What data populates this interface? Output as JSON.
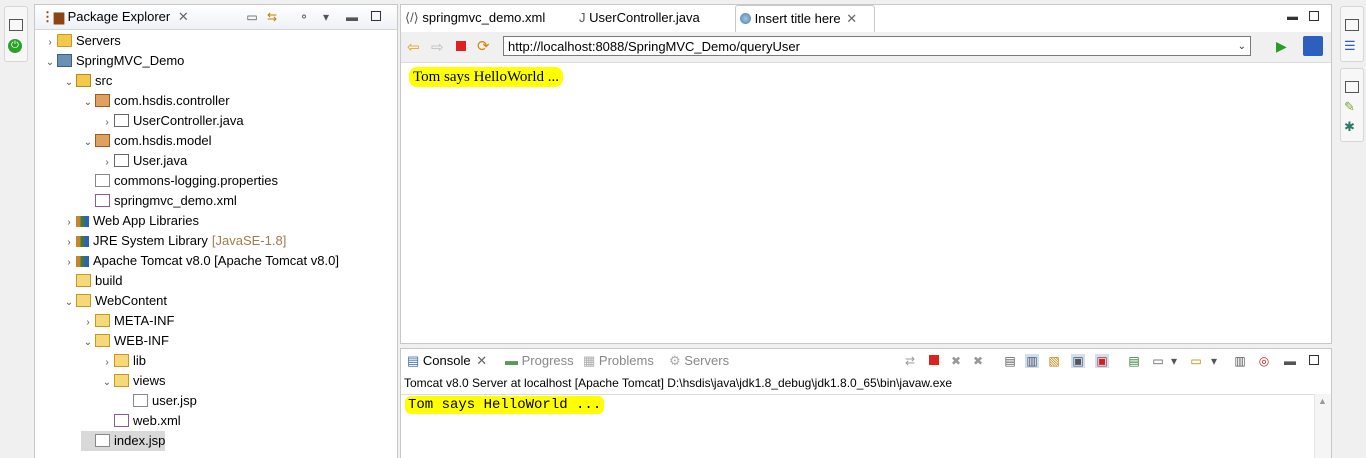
{
  "package_explorer": {
    "title": "Package Explorer",
    "tree": [
      {
        "label": "Servers",
        "icon": "folder-servers-icon",
        "expander": "collapsed",
        "depth": 0
      },
      {
        "label": "SpringMVC_Demo",
        "icon": "web-project-icon",
        "expander": "expanded",
        "depth": 0
      },
      {
        "label": "src",
        "icon": "source-folder-icon",
        "expander": "expanded",
        "depth": 1
      },
      {
        "label": "com.hsdis.controller",
        "icon": "package-icon",
        "expander": "expanded",
        "depth": 2
      },
      {
        "label": "UserController.java",
        "icon": "java-file-icon",
        "expander": "collapsed",
        "depth": 3
      },
      {
        "label": "com.hsdis.model",
        "icon": "package-icon",
        "expander": "expanded",
        "depth": 2
      },
      {
        "label": "User.java",
        "icon": "java-file-icon",
        "expander": "collapsed",
        "depth": 3
      },
      {
        "label": "commons-logging.properties",
        "icon": "properties-file-icon",
        "expander": "none",
        "depth": 2
      },
      {
        "label": "springmvc_demo.xml",
        "icon": "xml-file-icon",
        "expander": "none",
        "depth": 2
      },
      {
        "label": "Web App Libraries",
        "icon": "library-icon",
        "expander": "collapsed",
        "depth": 1
      },
      {
        "label": "JRE System Library",
        "suffix": "[JavaSE-1.8]",
        "icon": "library-icon",
        "expander": "collapsed",
        "depth": 1
      },
      {
        "label": "Apache Tomcat v8.0 [Apache Tomcat v8.0]",
        "icon": "library-icon",
        "expander": "collapsed",
        "depth": 1
      },
      {
        "label": "build",
        "icon": "folder-icon",
        "expander": "none",
        "depth": 1
      },
      {
        "label": "WebContent",
        "icon": "folder-icon",
        "expander": "expanded",
        "depth": 1
      },
      {
        "label": "META-INF",
        "icon": "folder-icon",
        "expander": "collapsed",
        "depth": 2
      },
      {
        "label": "WEB-INF",
        "icon": "folder-icon",
        "expander": "expanded",
        "depth": 2
      },
      {
        "label": "lib",
        "icon": "folder-icon",
        "expander": "collapsed",
        "depth": 3
      },
      {
        "label": "views",
        "icon": "folder-icon",
        "expander": "expanded",
        "depth": 3
      },
      {
        "label": "user.jsp",
        "icon": "jsp-file-icon",
        "expander": "none",
        "depth": 4
      },
      {
        "label": "web.xml",
        "icon": "xml-file-icon",
        "expander": "none",
        "depth": 3
      },
      {
        "label": "index.jsp",
        "icon": "jsp-file-icon",
        "expander": "none",
        "depth": 2,
        "selected": true
      }
    ]
  },
  "editor": {
    "tabs": [
      {
        "label": "springmvc_demo.xml",
        "icon": "xml-file-icon",
        "active": false
      },
      {
        "label": "UserController.java",
        "icon": "java-file-icon",
        "active": false
      },
      {
        "label": "Insert title here",
        "icon": "globe-icon",
        "active": true
      }
    ],
    "url": "http://localhost:8088/SpringMVC_Demo/queryUser",
    "page_text": "Tom says HelloWorld ..."
  },
  "console": {
    "tabs": [
      {
        "label": "Console",
        "active": true
      },
      {
        "label": "Progress",
        "active": false
      },
      {
        "label": "Problems",
        "active": false
      },
      {
        "label": "Servers",
        "active": false
      }
    ],
    "description": "Tomcat v8.0 Server at localhost [Apache Tomcat] D:\\hsdis\\java\\jdk1.8_debug\\jdk1.8.0_65\\bin\\javaw.exe",
    "output": "Tom says HelloWorld ..."
  },
  "colors": {
    "highlight": "#ffff00",
    "accent": "#1a5fb4",
    "library_suffix": "#a07b4d"
  }
}
